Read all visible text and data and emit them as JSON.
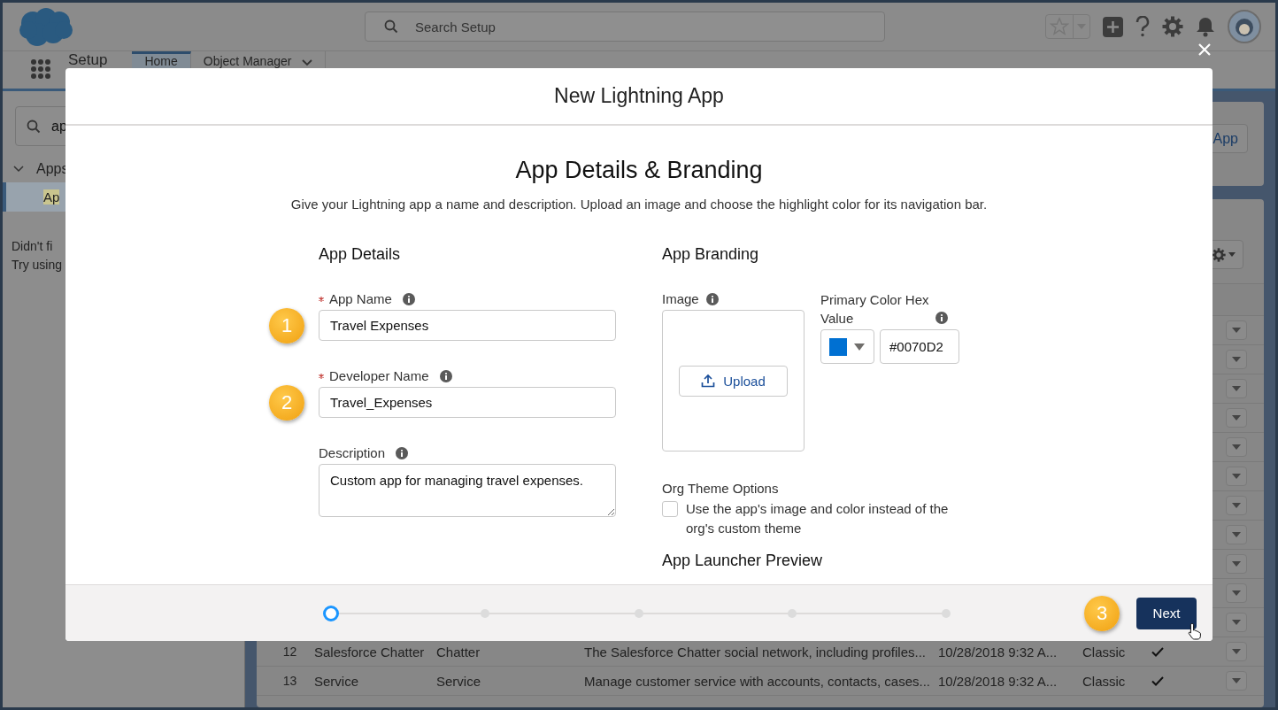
{
  "header": {
    "search": {
      "placeholder": "Search Setup"
    }
  },
  "nav": {
    "app_name": "Setup",
    "tabs": [
      {
        "label": "Home",
        "selected": true
      },
      {
        "label": "Object Manager",
        "selected": false
      }
    ]
  },
  "sidebar": {
    "search": {
      "value": "ap"
    },
    "tree": [
      {
        "label": "Apps",
        "expanded": true,
        "children": [
          {
            "label": "Ap",
            "selected": true
          }
        ]
      }
    ],
    "hint_lines": [
      "Didn't fi",
      "Try using"
    ]
  },
  "content": {
    "new_button": "App",
    "table": {
      "rows": [
        {
          "kind": "covered"
        },
        {
          "kind": "covered"
        },
        {
          "kind": "covered"
        },
        {
          "kind": "covered"
        },
        {
          "kind": "covered"
        },
        {
          "kind": "covered"
        },
        {
          "kind": "covered"
        },
        {
          "kind": "covered"
        },
        {
          "kind": "covered"
        },
        {
          "kind": "covered"
        },
        {
          "kind": "covered"
        },
        {
          "kind": "full",
          "number": "12",
          "app_name": "Salesforce Chatter",
          "developer_name": "Chatter",
          "description": "The Salesforce Chatter social network, including profiles...",
          "last_modified": "10/28/2018 9:32 A...",
          "app_type": "Classic",
          "checked": true
        },
        {
          "kind": "full",
          "number": "13",
          "app_name": "Service",
          "developer_name": "Service",
          "description": "Manage customer service with accounts, contacts, cases...",
          "last_modified": "10/28/2018 9:32 A...",
          "app_type": "Classic",
          "checked": true
        }
      ]
    }
  },
  "modal": {
    "title": "New Lightning App",
    "heading": "App Details & Branding",
    "description": "Give your Lightning app a name and description. Upload an image and choose the highlight color for its navigation bar.",
    "details": {
      "title": "App Details",
      "fields": [
        {
          "kind": "input",
          "label": "App Name",
          "required": true,
          "value": "Travel Expenses",
          "callout": "1"
        },
        {
          "kind": "input",
          "label": "Developer Name",
          "required": true,
          "value": "Travel_Expenses",
          "callout": "2"
        },
        {
          "kind": "textarea",
          "label": "Description",
          "required": false,
          "value": "Custom app for managing travel expenses."
        }
      ]
    },
    "branding": {
      "title": "App Branding",
      "image": {
        "label": "Image",
        "upload": "Upload"
      },
      "color": {
        "label": "Primary Color Hex Value",
        "value": "#0070D2"
      },
      "theme": {
        "title": "Org Theme Options",
        "checkbox": {
          "label": "Use the app's image and color instead of the org's custom theme",
          "checked": false
        }
      },
      "preview_title": "App Launcher Preview"
    },
    "steps": [
      {
        "selected": true
      },
      {
        "selected": false
      },
      {
        "selected": false
      },
      {
        "selected": false
      },
      {
        "selected": false
      }
    ],
    "next": {
      "label": "Next",
      "callout": "3"
    }
  }
}
